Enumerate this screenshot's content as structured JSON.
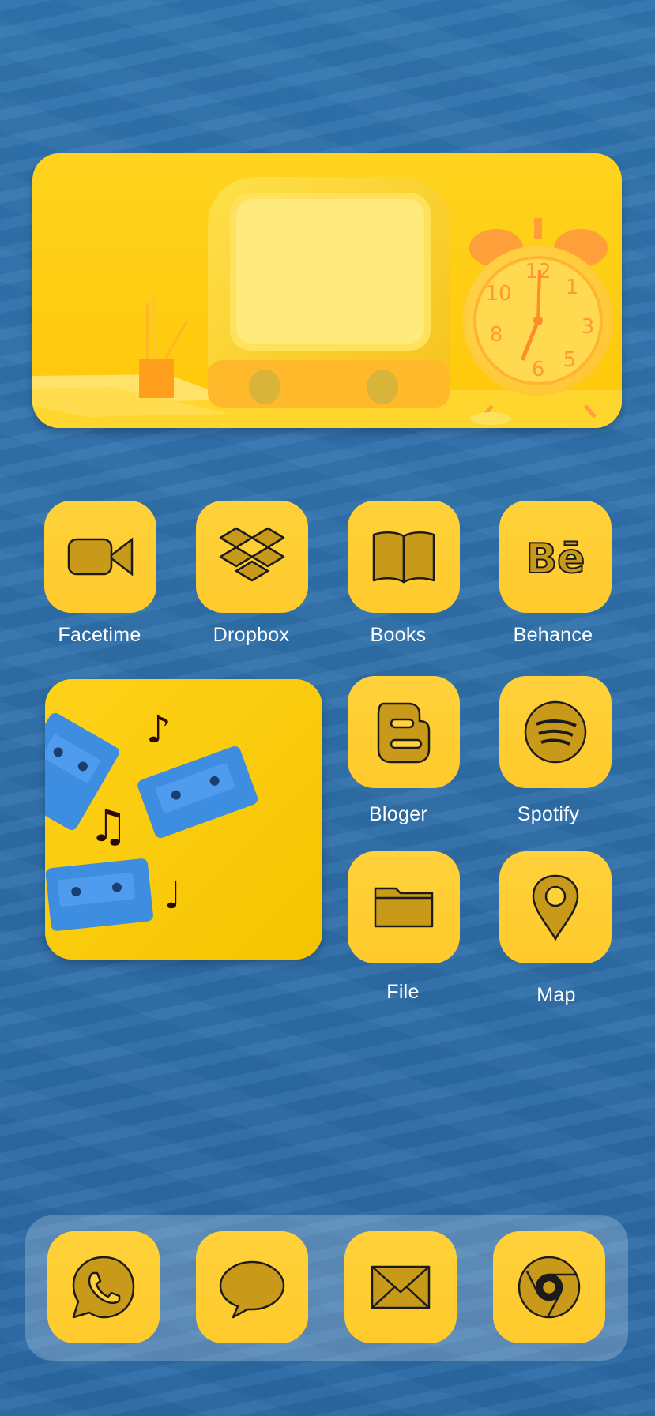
{
  "photo_widget": {
    "description_icon": "retro-desk-scene"
  },
  "apps": [
    {
      "id": "facetime",
      "label": "Facetime",
      "icon": "video-camera-icon"
    },
    {
      "id": "dropbox",
      "label": "Dropbox",
      "icon": "dropbox-icon"
    },
    {
      "id": "books",
      "label": "Books",
      "icon": "open-book-icon"
    },
    {
      "id": "behance",
      "label": "Behance",
      "icon": "behance-icon"
    },
    {
      "id": "bloger",
      "label": "Bloger",
      "icon": "blogger-icon"
    },
    {
      "id": "spotify",
      "label": "Spotify",
      "icon": "spotify-icon"
    },
    {
      "id": "file",
      "label": "File",
      "icon": "folder-icon"
    },
    {
      "id": "map",
      "label": "Map",
      "icon": "map-pin-icon"
    }
  ],
  "dock": [
    {
      "id": "whatsapp",
      "icon": "whatsapp-icon"
    },
    {
      "id": "messages",
      "icon": "chat-bubble-icon"
    },
    {
      "id": "mail",
      "icon": "envelope-icon"
    },
    {
      "id": "chrome",
      "icon": "chrome-icon"
    }
  ],
  "colors": {
    "wallpaper": "#2f70ab",
    "icon_bg": "#ffcb2e",
    "icon_stroke": "#1b1b1b",
    "label": "#ffffff"
  }
}
